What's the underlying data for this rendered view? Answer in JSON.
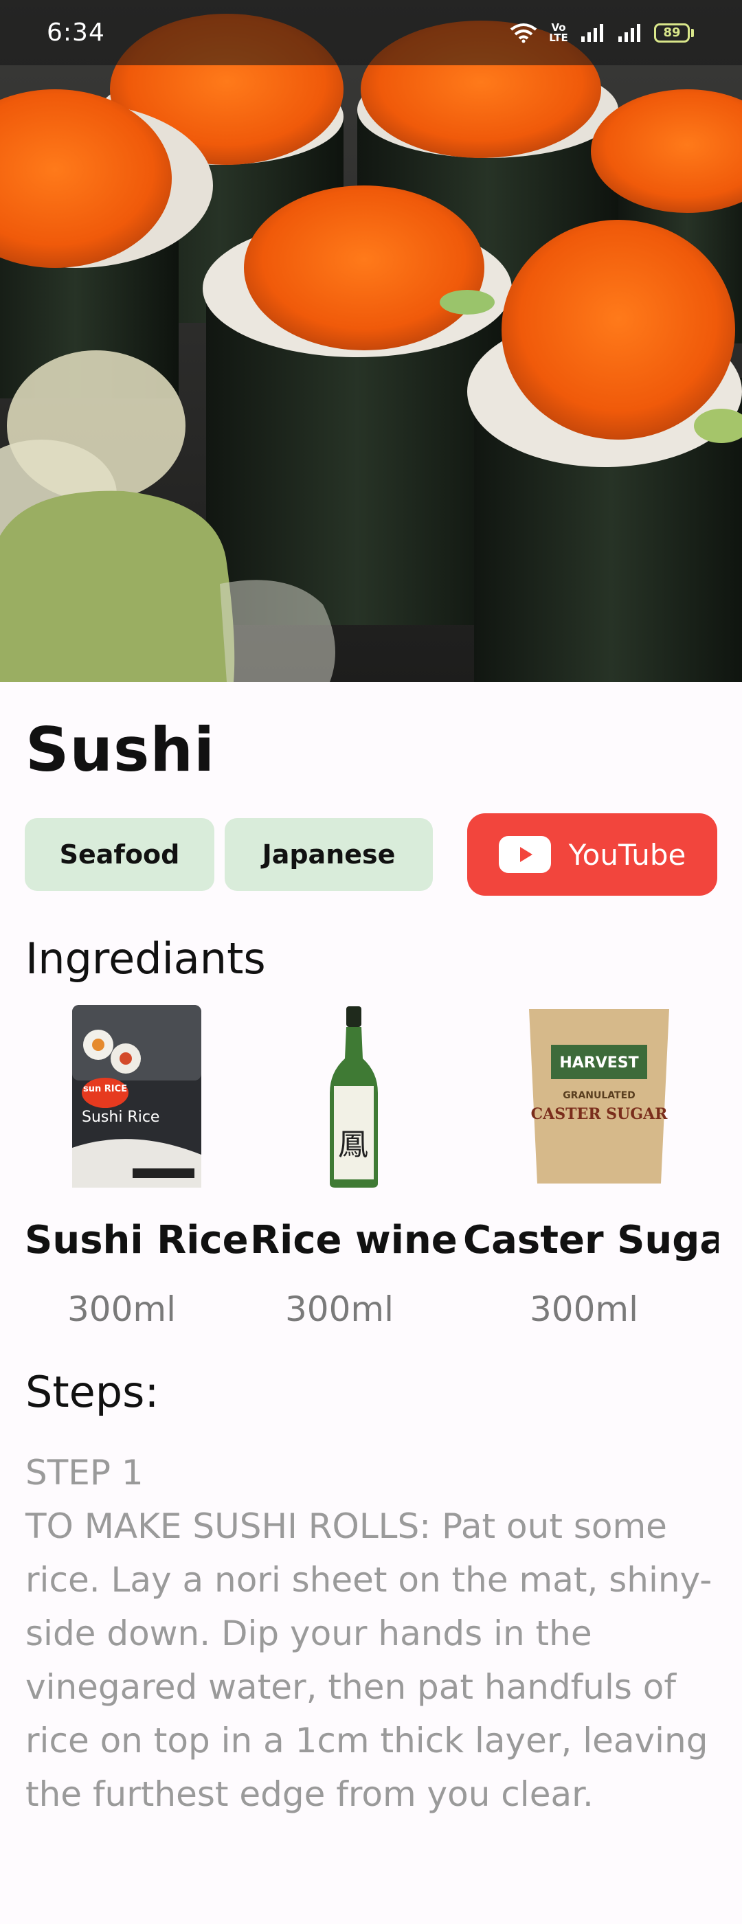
{
  "status_bar": {
    "time": "6:34",
    "network_label": "Vo LTE",
    "battery": "89"
  },
  "recipe": {
    "title": "Sushi",
    "tags": [
      "Seafood",
      "Japanese"
    ],
    "youtube_label": "YouTube"
  },
  "ingredients": {
    "heading": "Ingrediants",
    "items": [
      {
        "name": "Sushi Rice",
        "amount": "300ml",
        "package_brand": "sun RICE",
        "package_label": "Sushi Rice"
      },
      {
        "name": "Rice wine",
        "amount": "300ml"
      },
      {
        "name": "Caster Suga",
        "amount": "300ml",
        "package_brand": "HARVEST",
        "package_label": "CASTER SUGAR",
        "package_sub": "GRANULATED"
      }
    ]
  },
  "steps": {
    "heading": "Steps:",
    "step_label": "STEP 1",
    "step_text": "TO MAKE SUSHI ROLLS: Pat out some rice. Lay a nori sheet on the mat, shiny-side down. Dip your hands in the vinegared water, then pat handfuls of rice on top in a 1cm thick layer, leaving the furthest edge from you clear."
  },
  "colors": {
    "tag_background": "#d9ecda",
    "youtube_red": "#f2453d",
    "background": "#fefbfe"
  }
}
